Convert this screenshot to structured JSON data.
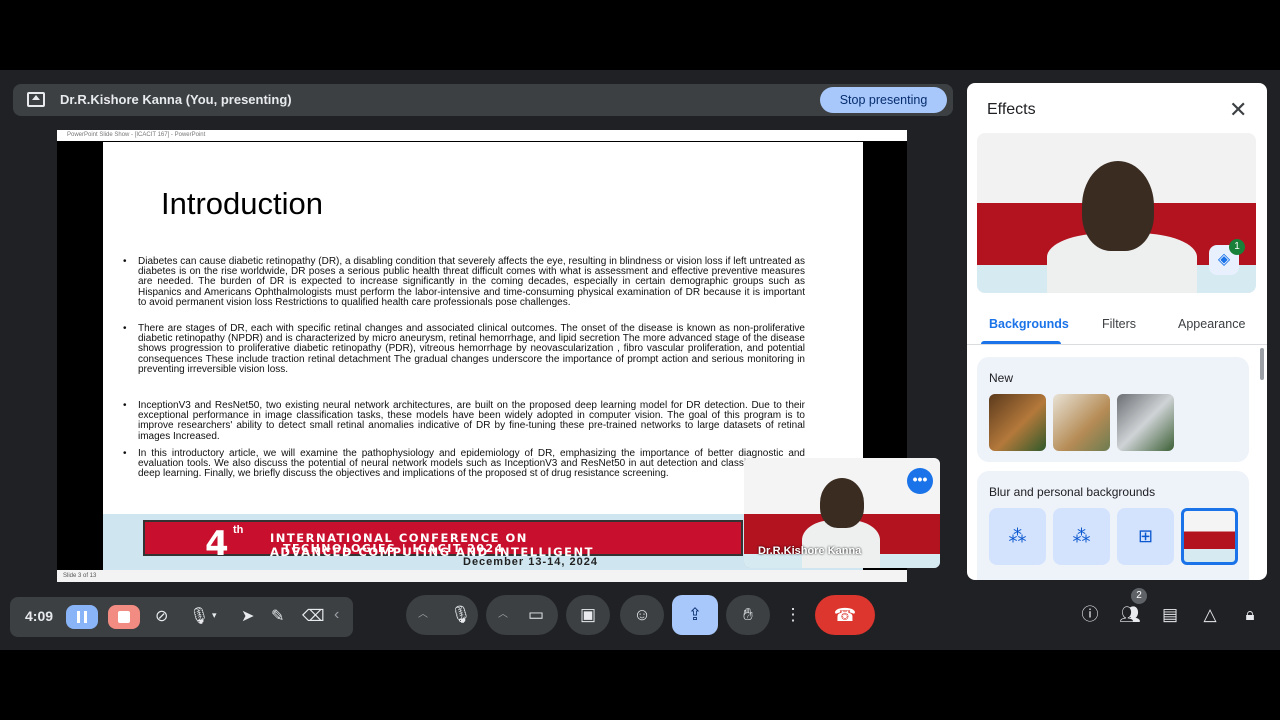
{
  "presenting_bar": {
    "name": "Dr.R.Kishore Kanna (You, presenting)",
    "stop_label": "Stop presenting"
  },
  "slide": {
    "window_title": "PowerPoint Slide Show - [ICACIT 167] - PowerPoint",
    "title": "Introduction",
    "bullets": [
      "Diabetes can cause diabetic retinopathy (DR), a disabling condition that severely affects the eye, resulting in blindness or vision loss if left untreated as diabetes is on the rise worldwide, DR poses a serious public health threat difficult comes with what is assessment and effective preventive measures are needed. The burden of DR is expected to increase significantly in the coming decades, especially in certain demographic groups such as Hispanics and Americans Ophthalmologists must perform the labor-intensive and time-consuming physical examination of DR because it is important to avoid permanent vision loss Restrictions to qualified health care professionals pose challenges.",
      "There are stages of DR, each with specific retinal changes and associated clinical outcomes. The onset of the disease is known as non-proliferative diabetic retinopathy (NPDR) and is characterized by micro aneurysm, retinal hemorrhage, and lipid secretion The more advanced stage of the disease shows progression to proliferative diabetic retinopathy (PDR), vitreous hemorrhage by neovascularization , fibro vascular proliferation, and potential consequences These include traction retinal detachment The gradual changes underscore the importance of prompt action and serious monitoring in preventing irreversible vision loss.",
      "InceptionV3 and ResNet50, two existing neural network architectures, are built on the proposed deep learning model for DR detection. Due to their exceptional performance in image classification tasks, these models have been widely adopted in computer vision. The goal of this program is to improve researchers' ability to detect small retinal anomalies indicative of DR by fine-tuning these pre-trained networks to large datasets of retinal images Increased.",
      "In this introductory article, we will examine the pathophysiology and epidemiology of DR, emphasizing the importance of better diagnostic and evaluation tools. We also discuss the potential of neural network models such as InceptionV3 and ResNet50 in aut detection and classification using deep learning. Finally, we briefly discuss the objectives and implications of the proposed st of drug resistance screening."
    ],
    "banner_number": "4",
    "banner_sup": "th",
    "banner_line1": "INTERNATIONAL CONFERENCE ON",
    "banner_line2": "ADVANCED COMPUTING AND INTELLIGENT",
    "banner_line3": "TECHNOLOGIES | ICACIT 2024",
    "banner_dates": "December 13-14, 2024",
    "status": "Slide 3 of 13"
  },
  "self_tile": {
    "name": "Dr.R.Kishore Kanna",
    "more_icon": "more-dots-icon"
  },
  "effects": {
    "title": "Effects",
    "tabs": [
      "Backgrounds",
      "Filters",
      "Appearance"
    ],
    "active_tab": "Backgrounds",
    "preview_badge": "1",
    "sections": [
      {
        "title": "New"
      },
      {
        "title": "Blur and personal backgrounds"
      }
    ]
  },
  "controls": {
    "time": "4:09",
    "participants_count": "2",
    "accent": "#a8c7fa",
    "end_color": "#dc362e"
  }
}
